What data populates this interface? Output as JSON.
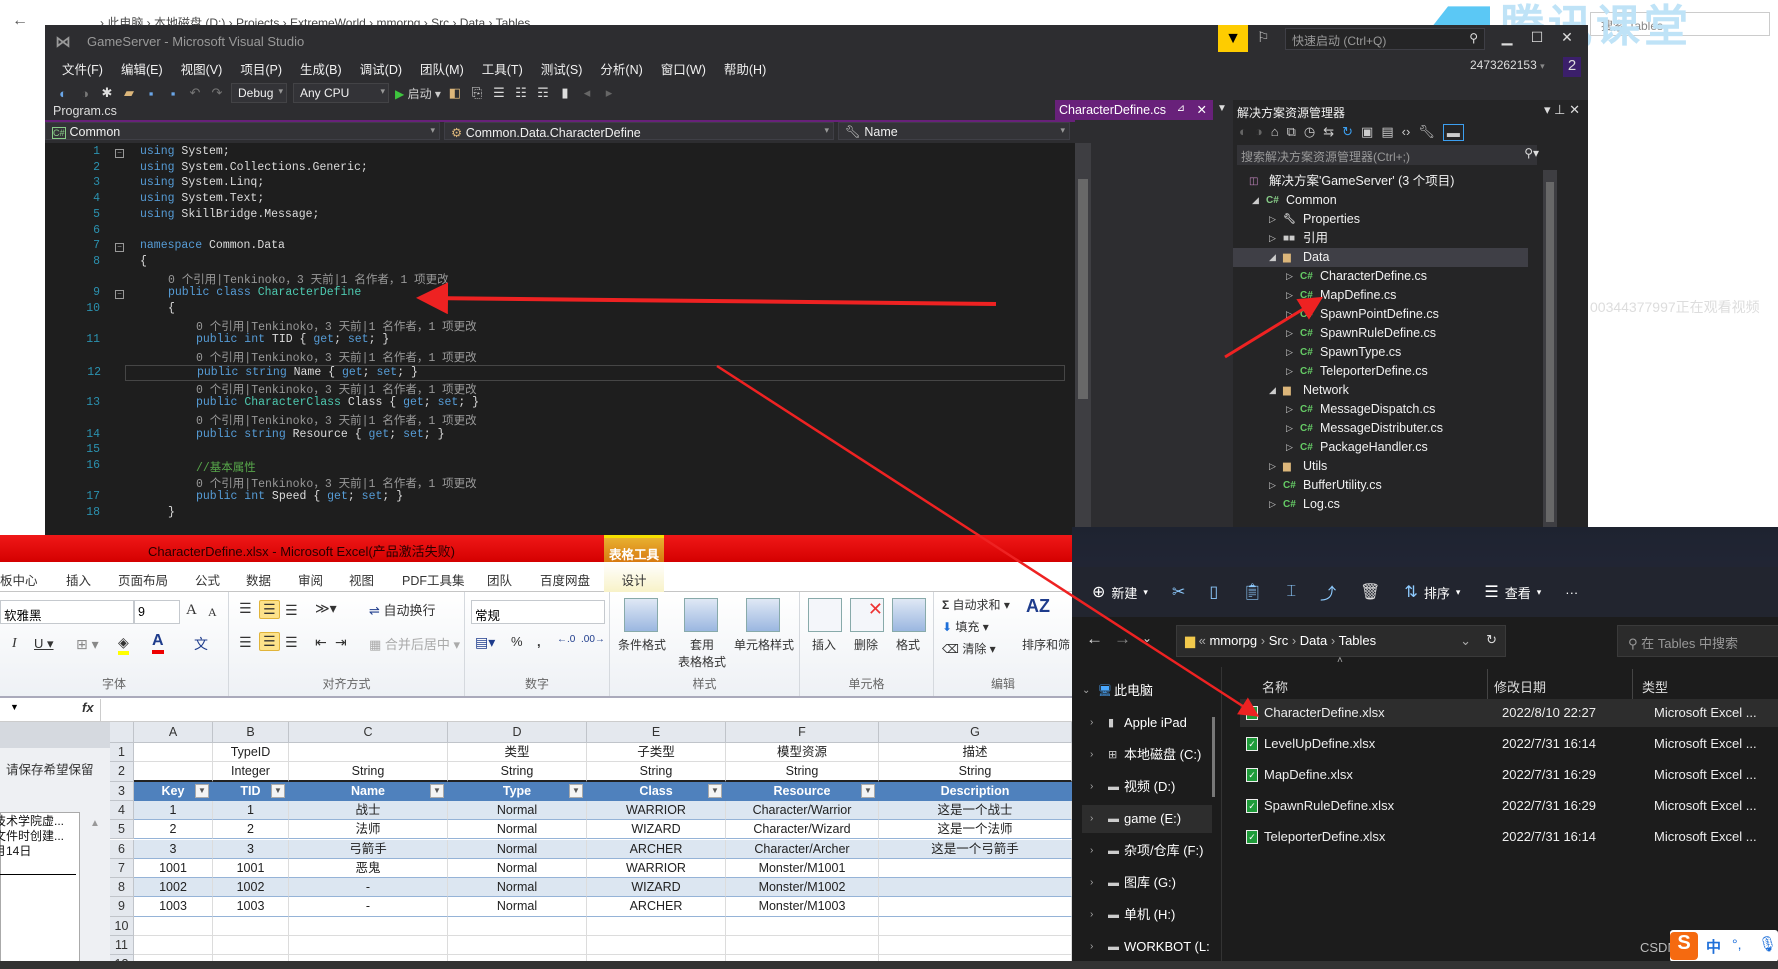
{
  "background_explorer": {
    "breadcrumb": "›  此电脑  ›  本地磁盘 (D:)  ›  Projects  ›  ExtremeWorld  ›  mmorpg  ›  Src  ›  Data  ›  Tables",
    "search_placeholder": "搜索 Tables",
    "watermark": "腾讯课堂",
    "viewer_note": "00344377997正在观看视频"
  },
  "vs": {
    "title": "GameServer - Microsoft Visual Studio",
    "quick_launch_placeholder": "快速启动 (Ctrl+Q)",
    "user": "2473262153",
    "notification_count": "2",
    "menu": [
      "文件(F)",
      "编辑(E)",
      "视图(V)",
      "项目(P)",
      "生成(B)",
      "调试(D)",
      "团队(M)",
      "工具(T)",
      "测试(S)",
      "分析(N)",
      "窗口(W)",
      "帮助(H)"
    ],
    "toolbar": {
      "config": "Debug",
      "platform": "Any CPU",
      "start_label": "启动"
    },
    "tabs": {
      "inactive": "Program.cs",
      "active": "CharacterDefine.cs"
    },
    "nav": {
      "project": "Common",
      "type": "Common.Data.CharacterDefine",
      "member": "Name"
    },
    "code_lens": "0 个引用|Tenkinoko，3 天前|1 名作者，1 项更改",
    "code": [
      {
        "n": "1",
        "i": 0,
        "t": [
          [
            "kw",
            "using"
          ],
          [
            "pl",
            " System;"
          ]
        ]
      },
      {
        "n": "2",
        "i": 0,
        "t": [
          [
            "kw",
            "using"
          ],
          [
            "pl",
            " System.Collections.Generic;"
          ]
        ]
      },
      {
        "n": "3",
        "i": 0,
        "t": [
          [
            "kw",
            "using"
          ],
          [
            "pl",
            " System.Linq;"
          ]
        ]
      },
      {
        "n": "4",
        "i": 0,
        "t": [
          [
            "kw",
            "using"
          ],
          [
            "pl",
            " System.Text;"
          ]
        ]
      },
      {
        "n": "5",
        "i": 0,
        "t": [
          [
            "kw",
            "using"
          ],
          [
            "pl",
            " SkillBridge.Message;"
          ]
        ]
      },
      {
        "n": "6",
        "i": 0,
        "t": []
      },
      {
        "n": "7",
        "i": 0,
        "t": [
          [
            "kw",
            "namespace"
          ],
          [
            "pl",
            " Common.Data"
          ]
        ]
      },
      {
        "n": "8",
        "i": 0,
        "t": [
          [
            "pl",
            "{"
          ]
        ]
      },
      {
        "n": "",
        "i": 1,
        "lens": true
      },
      {
        "n": "9",
        "i": 1,
        "t": [
          [
            "kw",
            "public class "
          ],
          [
            "ty",
            "CharacterDefine"
          ]
        ]
      },
      {
        "n": "10",
        "i": 1,
        "t": [
          [
            "pl",
            "{"
          ]
        ]
      },
      {
        "n": "",
        "i": 2,
        "lens": true
      },
      {
        "n": "11",
        "i": 2,
        "t": [
          [
            "kw",
            "public int "
          ],
          [
            "pl",
            "TID { "
          ],
          [
            "kw",
            "get"
          ],
          [
            "pl",
            "; "
          ],
          [
            "kw",
            "set"
          ],
          [
            "pl",
            "; }"
          ]
        ]
      },
      {
        "n": "",
        "i": 2,
        "lens": true
      },
      {
        "n": "12",
        "i": 2,
        "cur": true,
        "t": [
          [
            "kw",
            "public string "
          ],
          [
            "pl",
            "Name { "
          ],
          [
            "kw",
            "get"
          ],
          [
            "pl",
            "; "
          ],
          [
            "kw",
            "set"
          ],
          [
            "pl",
            "; }"
          ]
        ]
      },
      {
        "n": "",
        "i": 2,
        "lens": true
      },
      {
        "n": "13",
        "i": 2,
        "t": [
          [
            "kw",
            "public "
          ],
          [
            "ty",
            "CharacterClass"
          ],
          [
            "pl",
            " Class { "
          ],
          [
            "kw",
            "get"
          ],
          [
            "pl",
            "; "
          ],
          [
            "kw",
            "set"
          ],
          [
            "pl",
            "; }"
          ]
        ]
      },
      {
        "n": "",
        "i": 2,
        "lens": true
      },
      {
        "n": "14",
        "i": 2,
        "t": [
          [
            "kw",
            "public string "
          ],
          [
            "pl",
            "Resource { "
          ],
          [
            "kw",
            "get"
          ],
          [
            "pl",
            "; "
          ],
          [
            "kw",
            "set"
          ],
          [
            "pl",
            "; }"
          ]
        ]
      },
      {
        "n": "15",
        "i": 2,
        "t": []
      },
      {
        "n": "16",
        "i": 2,
        "t": [
          [
            "cm",
            "//基本属性"
          ]
        ]
      },
      {
        "n": "",
        "i": 2,
        "lens": true
      },
      {
        "n": "17",
        "i": 2,
        "t": [
          [
            "kw",
            "public int "
          ],
          [
            "pl",
            "Speed { "
          ],
          [
            "kw",
            "get"
          ],
          [
            "pl",
            "; "
          ],
          [
            "kw",
            "set"
          ],
          [
            "pl",
            "; }"
          ]
        ]
      },
      {
        "n": "18",
        "i": 1,
        "t": [
          [
            "pl",
            "}"
          ]
        ]
      }
    ]
  },
  "solution_explorer": {
    "title": "解决方案资源管理器",
    "search_placeholder": "搜索解决方案资源管理器(Ctrl+;)",
    "tree": [
      {
        "label": "解决方案'GameServer' (3 个项目)",
        "level": 0,
        "icon": "solution",
        "arrow": ""
      },
      {
        "label": "Common",
        "level": 1,
        "icon": "csproj",
        "arrow": "open"
      },
      {
        "label": "Properties",
        "level": 2,
        "icon": "wrench",
        "arrow": "closed"
      },
      {
        "label": "引用",
        "level": 2,
        "icon": "references",
        "arrow": "closed"
      },
      {
        "label": "Data",
        "level": 2,
        "icon": "folder",
        "arrow": "open",
        "selected": true
      },
      {
        "label": "CharacterDefine.cs",
        "level": 3,
        "icon": "cs",
        "arrow": "closed"
      },
      {
        "label": "MapDefine.cs",
        "level": 3,
        "icon": "cs",
        "arrow": "closed"
      },
      {
        "label": "SpawnPointDefine.cs",
        "level": 3,
        "icon": "cs",
        "arrow": "closed"
      },
      {
        "label": "SpawnRuleDefine.cs",
        "level": 3,
        "icon": "cs",
        "arrow": "closed"
      },
      {
        "label": "SpawnType.cs",
        "level": 3,
        "icon": "cs",
        "arrow": "closed"
      },
      {
        "label": "TeleporterDefine.cs",
        "level": 3,
        "icon": "cs",
        "arrow": "closed"
      },
      {
        "label": "Network",
        "level": 2,
        "icon": "folder",
        "arrow": "open"
      },
      {
        "label": "MessageDispatch.cs",
        "level": 3,
        "icon": "cs",
        "arrow": "closed"
      },
      {
        "label": "MessageDistributer.cs",
        "level": 3,
        "icon": "cs",
        "arrow": "closed"
      },
      {
        "label": "PackageHandler.cs",
        "level": 3,
        "icon": "cs",
        "arrow": "closed"
      },
      {
        "label": "Utils",
        "level": 2,
        "icon": "folder",
        "arrow": "closed"
      },
      {
        "label": "BufferUtility.cs",
        "level": 2,
        "icon": "cs",
        "arrow": "closed"
      },
      {
        "label": "Log.cs",
        "level": 2,
        "icon": "cs",
        "arrow": "closed"
      }
    ]
  },
  "excel": {
    "title": "CharacterDefine.xlsx  -  Microsoft Excel(产品激活失败)",
    "context_tab_group": "表格工具",
    "tabs": [
      "板中心",
      "插入",
      "页面布局",
      "公式",
      "数据",
      "审阅",
      "视图",
      "PDF工具集",
      "团队",
      "百度网盘",
      "设计"
    ],
    "ribbon": {
      "font_name": "软雅黑",
      "font_size": "9",
      "wrap_text": "自动换行",
      "merge_center": "合并后居中",
      "number_format": "常规",
      "conditional_format": "条件格式",
      "table_format": "套用\n表格格式",
      "cell_style": "单元格样式",
      "insert": "插入",
      "delete": "删除",
      "format": "格式",
      "autosum": "自动求和",
      "fill": "填充",
      "clear": "清除",
      "sort_filter": "排序和筛",
      "groups": [
        "字体",
        "对齐方式",
        "数字",
        "样式",
        "单元格",
        "编辑"
      ]
    },
    "formula_label": "fx",
    "left_pane": {
      "note": "请保存希望保留",
      "items": [
        "技术学院虚...",
        "文件时创建...",
        "月14日"
      ]
    },
    "columns": [
      "A",
      "B",
      "C",
      "D",
      "E",
      "F",
      "G"
    ],
    "rows": [
      {
        "n": "1",
        "cells": [
          "",
          "TypeID",
          "",
          "类型",
          "子类型",
          "模型资源",
          "描述"
        ]
      },
      {
        "n": "2",
        "cells": [
          "",
          "Integer",
          "String",
          "String",
          "String",
          "String",
          "String"
        ]
      },
      {
        "n": "3",
        "header": true,
        "cells": [
          "Key",
          "TID",
          "Name",
          "Type",
          "Class",
          "Resource",
          "Description"
        ]
      },
      {
        "n": "4",
        "cells": [
          "1",
          "1",
          "战士",
          "Normal",
          "WARRIOR",
          "Character/Warrior",
          "这是一个战士"
        ]
      },
      {
        "n": "5",
        "cells": [
          "2",
          "2",
          "法师",
          "Normal",
          "WIZARD",
          "Character/Wizard",
          "这是一个法师"
        ]
      },
      {
        "n": "6",
        "cells": [
          "3",
          "3",
          "弓箭手",
          "Normal",
          "ARCHER",
          "Character/Archer",
          "这是一个弓箭手"
        ]
      },
      {
        "n": "7",
        "cells": [
          "1001",
          "1001",
          "恶鬼",
          "Normal",
          "WARRIOR",
          "Monster/M1001",
          ""
        ]
      },
      {
        "n": "8",
        "cells": [
          "1002",
          "1002",
          "-",
          "Normal",
          "WIZARD",
          "Monster/M1002",
          ""
        ]
      },
      {
        "n": "9",
        "cells": [
          "1003",
          "1003",
          "-",
          "Normal",
          "ARCHER",
          "Monster/M1003",
          ""
        ]
      },
      {
        "n": "10",
        "cells": [
          "",
          "",
          "",
          "",
          "",
          "",
          ""
        ]
      },
      {
        "n": "11",
        "cells": [
          "",
          "",
          "",
          "",
          "",
          "",
          ""
        ]
      },
      {
        "n": "12",
        "cells": [
          "",
          "",
          "",
          "",
          "",
          "",
          ""
        ]
      }
    ]
  },
  "file_explorer": {
    "commands": {
      "new": "新建",
      "sort": "排序",
      "view": "查看",
      "more": "···"
    },
    "path": [
      "«",
      "mmorpg",
      "Src",
      "Data",
      "Tables"
    ],
    "search_placeholder": "在 Tables 中搜索",
    "column_headers": [
      "名称",
      "修改日期",
      "类型"
    ],
    "nav": [
      {
        "label": "此电脑",
        "icon": "pc",
        "expanded": true
      },
      {
        "label": "Apple iPad",
        "icon": "device"
      },
      {
        "label": "本地磁盘 (C:)",
        "icon": "drive-windows"
      },
      {
        "label": "视频 (D:)",
        "icon": "drive"
      },
      {
        "label": "game (E:)",
        "icon": "drive",
        "selected": true
      },
      {
        "label": "杂项/仓库 (F:)",
        "icon": "drive"
      },
      {
        "label": "图库 (G:)",
        "icon": "drive"
      },
      {
        "label": "单机 (H:)",
        "icon": "drive"
      },
      {
        "label": "WORKBOT (L:",
        "icon": "drive"
      }
    ],
    "files": [
      {
        "name": "CharacterDefine.xlsx",
        "modified": "2022/8/10 22:27",
        "type": "Microsoft Excel ...",
        "selected": true
      },
      {
        "name": "LevelUpDefine.xlsx",
        "modified": "2022/7/31 16:14",
        "type": "Microsoft Excel ..."
      },
      {
        "name": "MapDefine.xlsx",
        "modified": "2022/7/31 16:29",
        "type": "Microsoft Excel ..."
      },
      {
        "name": "SpawnRuleDefine.xlsx",
        "modified": "2022/7/31 16:29",
        "type": "Microsoft Excel ..."
      },
      {
        "name": "TeleporterDefine.xlsx",
        "modified": "2022/7/31 16:14",
        "type": "Microsoft Excel ..."
      }
    ]
  },
  "taskbar": {
    "watermark": "CSDN @Tenkinoko",
    "ime_label": "中",
    "ime_logo": "S"
  },
  "colors": {
    "vs_accent": "#68217a",
    "excel_title": "#e00000",
    "table_header": "#4f81bd",
    "annotation_arrow": "#ee2222"
  }
}
